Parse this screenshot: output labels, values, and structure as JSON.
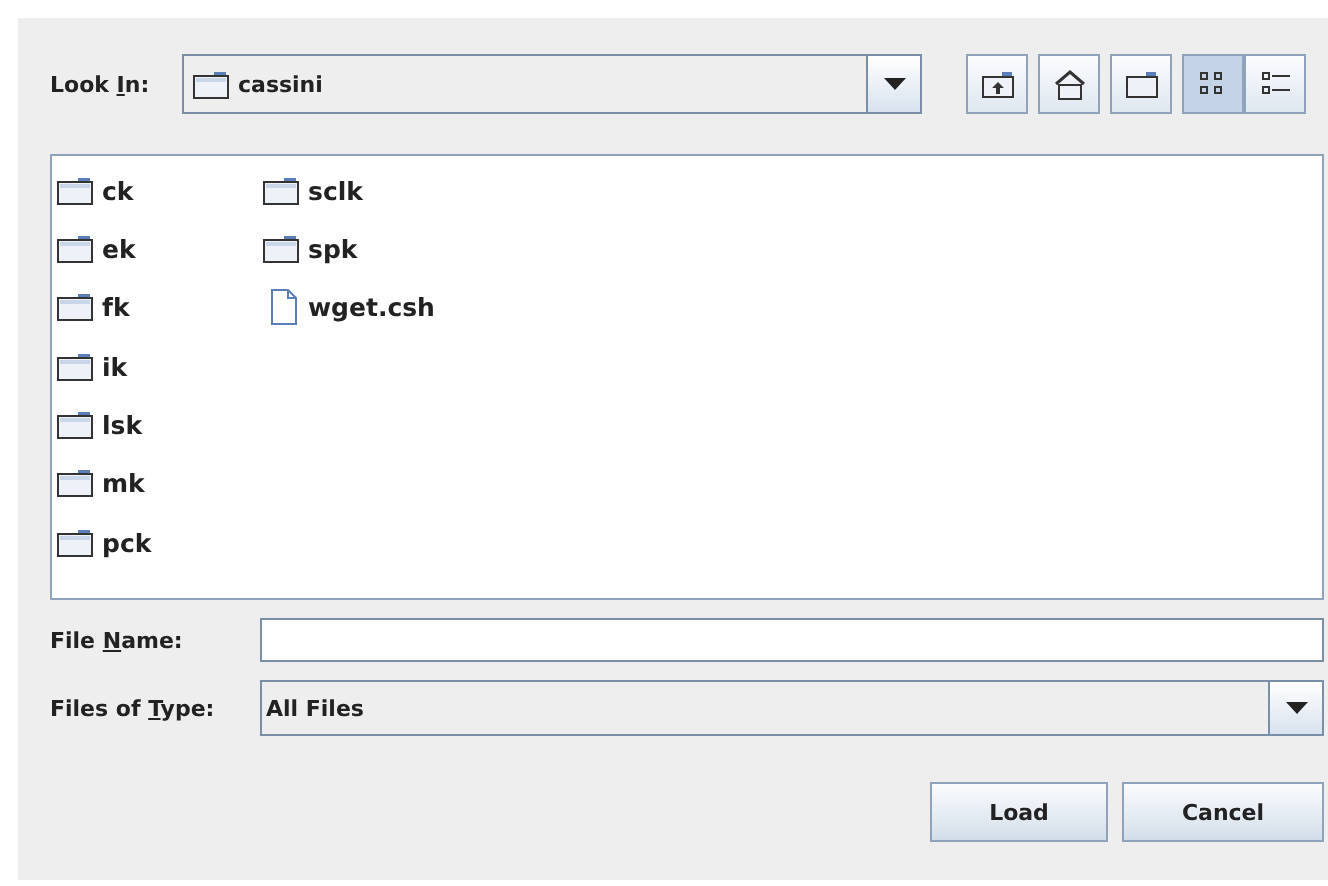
{
  "look_in": {
    "label": [
      "Look ",
      "I",
      "n:"
    ],
    "value": "cassini"
  },
  "toolbar": [
    {
      "kind": "up"
    },
    {
      "kind": "home"
    },
    {
      "kind": "newfolder"
    },
    {
      "kind": "list",
      "selected": true
    },
    {
      "kind": "details",
      "selected": false
    }
  ],
  "files": [
    {
      "name": "ck",
      "kind": "folder"
    },
    {
      "name": "ek",
      "kind": "folder"
    },
    {
      "name": "fk",
      "kind": "folder"
    },
    {
      "name": "ik",
      "kind": "folder"
    },
    {
      "name": "lsk",
      "kind": "folder"
    },
    {
      "name": "mk",
      "kind": "folder"
    },
    {
      "name": "pck",
      "kind": "folder"
    },
    {
      "name": "sclk",
      "kind": "folder"
    },
    {
      "name": "spk",
      "kind": "folder"
    },
    {
      "name": "wget.csh",
      "kind": "file"
    }
  ],
  "file_name": {
    "label": [
      "File ",
      "N",
      "ame:"
    ]
  },
  "file_type": {
    "label": [
      "Files of ",
      "T",
      "ype:"
    ],
    "value": "All Files"
  },
  "buttons": [
    "Load",
    "Cancel"
  ]
}
